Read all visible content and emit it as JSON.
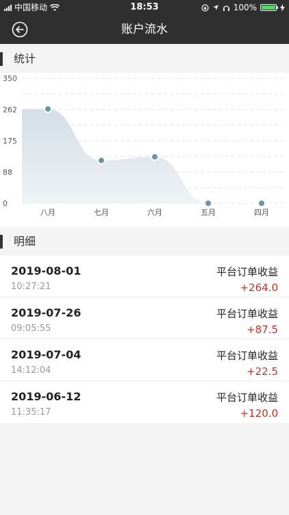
{
  "status_bar": {
    "carrier": "中国移动",
    "time": "18:53",
    "battery": "100%",
    "battery_level": 1.0
  },
  "nav": {
    "title": "账户流水",
    "back_icon": "back-circle-arrow-icon"
  },
  "sections": {
    "stats_title": "统计",
    "detail_title": "明细"
  },
  "chart_data": {
    "type": "area",
    "categories": [
      "八月",
      "七月",
      "六月",
      "五月",
      "四月"
    ],
    "values": [
      264,
      120,
      130,
      0,
      0
    ],
    "yticks": [
      "350",
      "262",
      "175",
      "88",
      "0"
    ],
    "ylim": [
      0,
      350
    ],
    "grid": "dashed-horizontal",
    "colors": {
      "area": "#d9e3ea",
      "point": "#6c93a6"
    }
  },
  "transactions": [
    {
      "date": "2019-08-01",
      "time": "10:27:21",
      "type": "平台订单收益",
      "amount": "+264.0"
    },
    {
      "date": "2019-07-26",
      "time": "09:05:55",
      "type": "平台订单收益",
      "amount": "+87.5"
    },
    {
      "date": "2019-07-04",
      "time": "14:12:04",
      "type": "平台订单收益",
      "amount": "+22.5"
    },
    {
      "date": "2019-06-12",
      "time": "11:35:17",
      "type": "平台订单收益",
      "amount": "+120.0"
    }
  ],
  "colors": {
    "header_bg": "#2f2f2f",
    "amount": "#c9302c"
  }
}
